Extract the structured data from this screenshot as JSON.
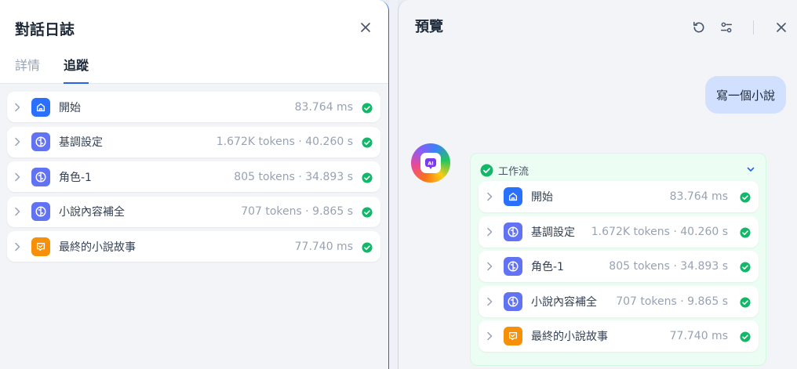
{
  "left": {
    "title": "對話日誌",
    "tabs": [
      {
        "label": "詳情",
        "active": false
      },
      {
        "label": "追蹤",
        "active": true
      }
    ],
    "trace": [
      {
        "label": "開始",
        "meta": "83.764 ms",
        "icon": "home-icon",
        "color": "#2970ff"
      },
      {
        "label": "基調設定",
        "meta": "1.672K tokens · 40.260 s",
        "icon": "llm-brain-icon",
        "color": "#6172f3"
      },
      {
        "label": "角色-1",
        "meta": "805 tokens · 34.893 s",
        "icon": "llm-brain-icon",
        "color": "#6172f3"
      },
      {
        "label": "小說內容補全",
        "meta": "707 tokens · 9.865 s",
        "icon": "llm-brain-icon",
        "color": "#6172f3"
      },
      {
        "label": "最終的小說故事",
        "meta": "77.740 ms",
        "icon": "answer-icon",
        "color": "#f79009"
      }
    ]
  },
  "right": {
    "title": "預覽",
    "user_message": "寫一個小說",
    "workflow": {
      "title": "工作流",
      "steps": [
        {
          "label": "開始",
          "meta": "83.764 ms",
          "icon": "home-icon",
          "color": "#2970ff"
        },
        {
          "label": "基調設定",
          "meta": "1.672K tokens · 40.260 s",
          "icon": "llm-brain-icon",
          "color": "#6172f3"
        },
        {
          "label": "角色-1",
          "meta": "805 tokens · 34.893 s",
          "icon": "llm-brain-icon",
          "color": "#6172f3"
        },
        {
          "label": "小說內容補全",
          "meta": "707 tokens · 9.865 s",
          "icon": "llm-brain-icon",
          "color": "#6172f3"
        },
        {
          "label": "最終的小說故事",
          "meta": "77.740 ms",
          "icon": "answer-icon",
          "color": "#f79009"
        }
      ]
    }
  },
  "colors": {
    "accent": "#2563eb",
    "success": "#12b76a",
    "start_node": "#2970ff",
    "llm_node": "#6172f3",
    "answer_node": "#f79009"
  }
}
